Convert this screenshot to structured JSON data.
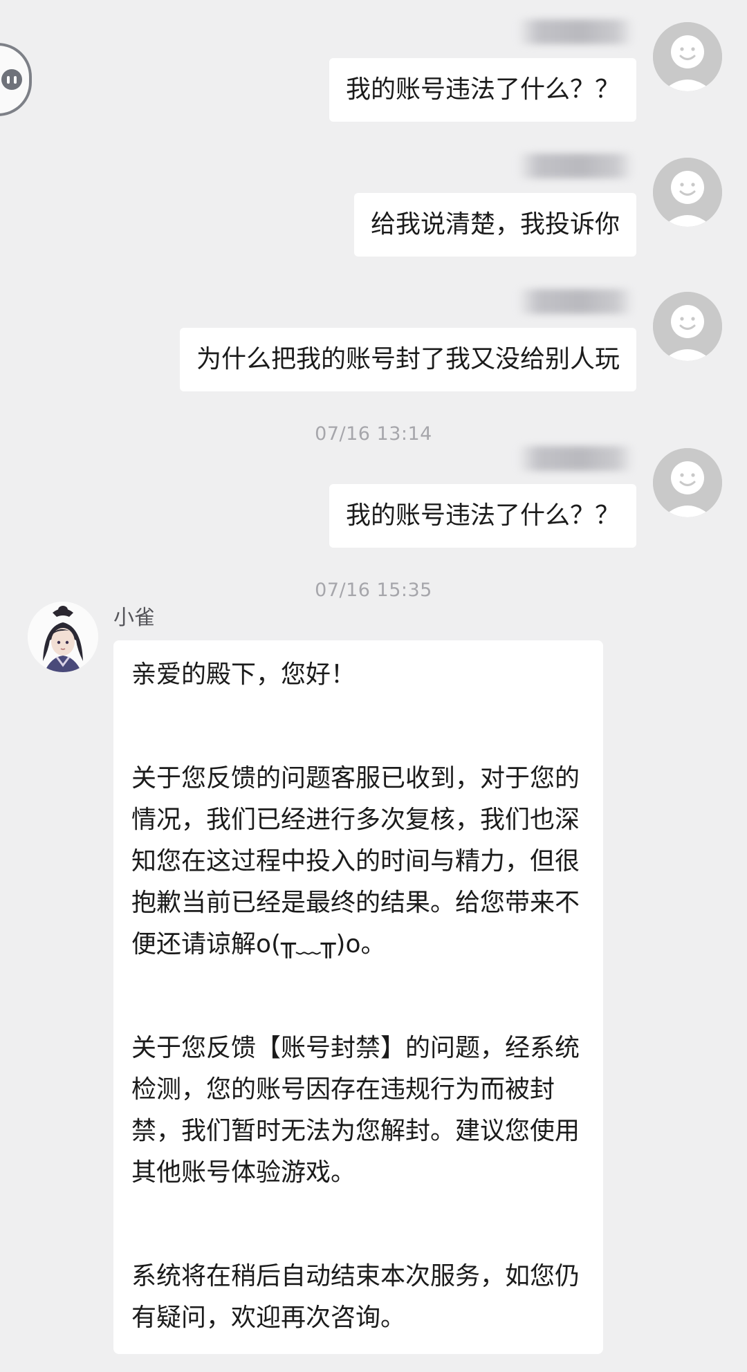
{
  "messages": [
    {
      "text": "我的账号违法了什么？？"
    },
    {
      "text": "给我说清楚，我投诉你"
    },
    {
      "text": "为什么把我的账号封了我又没给别人玩"
    },
    {
      "text": "我的账号违法了什么？？"
    }
  ],
  "timestamps": [
    "07/16 13:14",
    "07/16 15:35"
  ],
  "agent": {
    "name": "小雀",
    "paragraphs": [
      "亲爱的殿下，您好！",
      "关于您反馈的问题客服已收到，对于您的情况，我们已经进行多次复核，我们也深知您在这过程中投入的时间与精力，但很抱歉当前已经是最终的结果。给您带来不便还请谅解o(╥﹏╥)o。",
      "关于您反馈【账号封禁】的问题，经系统检测，您的账号因存在违规行为而被封禁，我们暂时无法为您解封。建议您使用其他账号体验游戏。",
      "系统将在稍后自动结束本次服务，如您仍有疑问，欢迎再次咨询。"
    ]
  },
  "colors": {
    "background": "#efeff0",
    "bubble": "#ffffff",
    "timestamp": "#a6a6ab",
    "avatar_placeholder": "#c9c9c9"
  },
  "icons": [
    "floating-assist-icon",
    "default-user-avatar-icon",
    "agent-character-avatar"
  ]
}
